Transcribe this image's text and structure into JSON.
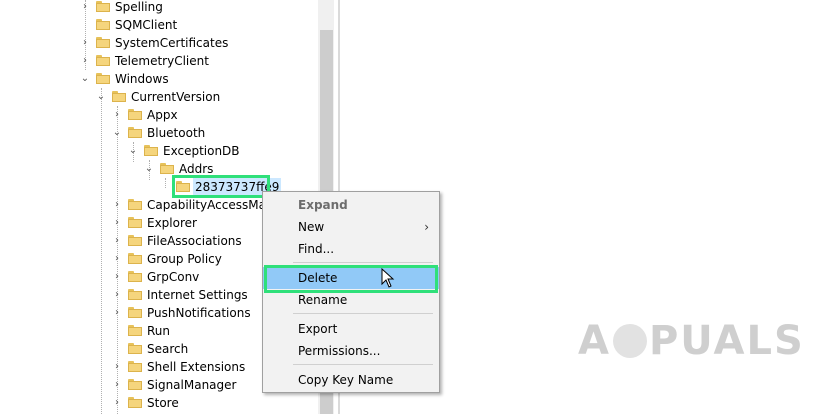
{
  "tree": {
    "items": [
      {
        "label": "Spelling",
        "expanded": false
      },
      {
        "label": "SQMClient",
        "expanded": false
      },
      {
        "label": "SystemCertificates",
        "expanded": false
      },
      {
        "label": "TelemetryClient",
        "expanded": false
      },
      {
        "label": "Windows",
        "expanded": true
      },
      {
        "label": "CurrentVersion",
        "expanded": true
      },
      {
        "label": "Appx",
        "expanded": false
      },
      {
        "label": "Bluetooth",
        "expanded": true
      },
      {
        "label": "ExceptionDB",
        "expanded": true
      },
      {
        "label": "Addrs",
        "expanded": true
      },
      {
        "label": "28373737ffe9",
        "selected": true
      },
      {
        "label": "CapabilityAccessMana",
        "expanded": false
      },
      {
        "label": "Explorer",
        "expanded": false
      },
      {
        "label": "FileAssociations",
        "expanded": false
      },
      {
        "label": "Group Policy",
        "expanded": false
      },
      {
        "label": "GrpConv",
        "expanded": false
      },
      {
        "label": "Internet Settings",
        "expanded": false
      },
      {
        "label": "PushNotifications",
        "expanded": false
      },
      {
        "label": "Run",
        "expanded": false
      },
      {
        "label": "Search",
        "expanded": false
      },
      {
        "label": "Shell Extensions",
        "expanded": false
      },
      {
        "label": "SignalManager",
        "expanded": false
      },
      {
        "label": "Store",
        "expanded": false
      }
    ]
  },
  "context_menu": {
    "items": [
      {
        "label": "Expand",
        "disabled": true
      },
      {
        "label": "New",
        "submenu": true
      },
      {
        "label": "Find..."
      },
      {
        "label": "Delete",
        "highlighted": true
      },
      {
        "label": "Rename"
      },
      {
        "label": "Export"
      },
      {
        "label": "Permissions..."
      },
      {
        "label": "Copy Key Name"
      }
    ]
  },
  "watermark": {
    "text_a": "A",
    "text_rest": "PUALS"
  },
  "colors": {
    "highlight_box": "#2fe07a",
    "selection": "#91c9f7",
    "folder": "#f5d57d"
  }
}
